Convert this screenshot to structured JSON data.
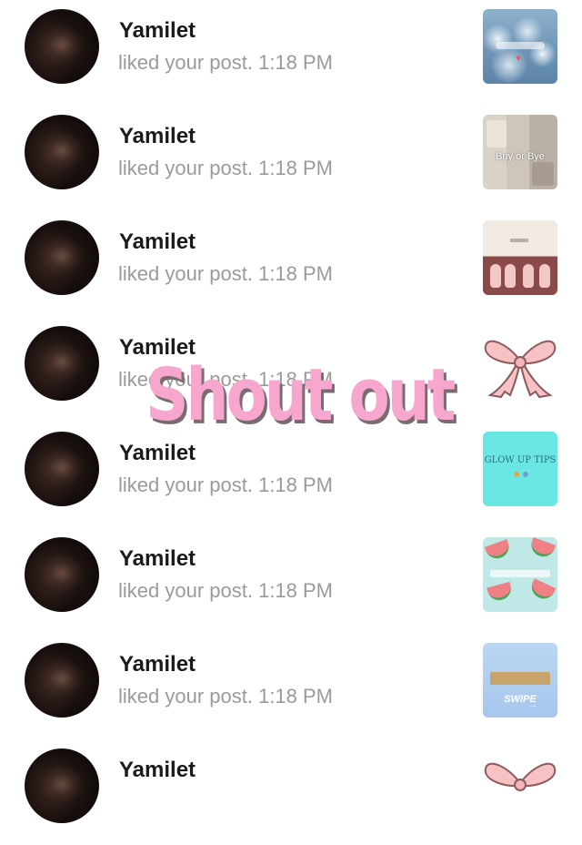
{
  "notifications": [
    {
      "name": "Yamilet",
      "text": "liked your post. 1:18 PM",
      "thumb_text": "",
      "thumb_icon": "snow-clouds-image"
    },
    {
      "name": "Yamilet",
      "text": "liked your post. 1:18 PM",
      "thumb_text": "Buy or Bye",
      "thumb_icon": "fashion-collage-image"
    },
    {
      "name": "Yamilet",
      "text": "liked your post. 1:18 PM",
      "thumb_text": "",
      "thumb_icon": "nails-image"
    },
    {
      "name": "Yamilet",
      "text": "liked your post. 1:18 PM",
      "thumb_text": "",
      "thumb_icon": "pink-bow-image"
    },
    {
      "name": "Yamilet",
      "text": "liked your post. 1:18 PM",
      "thumb_text": "GLOW UP TIPS",
      "thumb_icon": "glow-up-tips-image"
    },
    {
      "name": "Yamilet",
      "text": "liked your post. 1:18 PM",
      "thumb_text": "",
      "thumb_icon": "watermelon-pattern-image"
    },
    {
      "name": "Yamilet",
      "text": "liked your post. 1:18 PM",
      "thumb_text": "SWIPE",
      "thumb_icon": "bucket-list-image"
    },
    {
      "name": "Yamilet",
      "text": "",
      "thumb_text": "",
      "thumb_icon": "pink-bow-image"
    }
  ],
  "overlay": {
    "text": "Shout out"
  },
  "colors": {
    "name": "#1a1a1a",
    "subtext": "#9a9a9a",
    "overlay": "#f7a6cd",
    "overlay_shadow": "#7a6b70"
  }
}
